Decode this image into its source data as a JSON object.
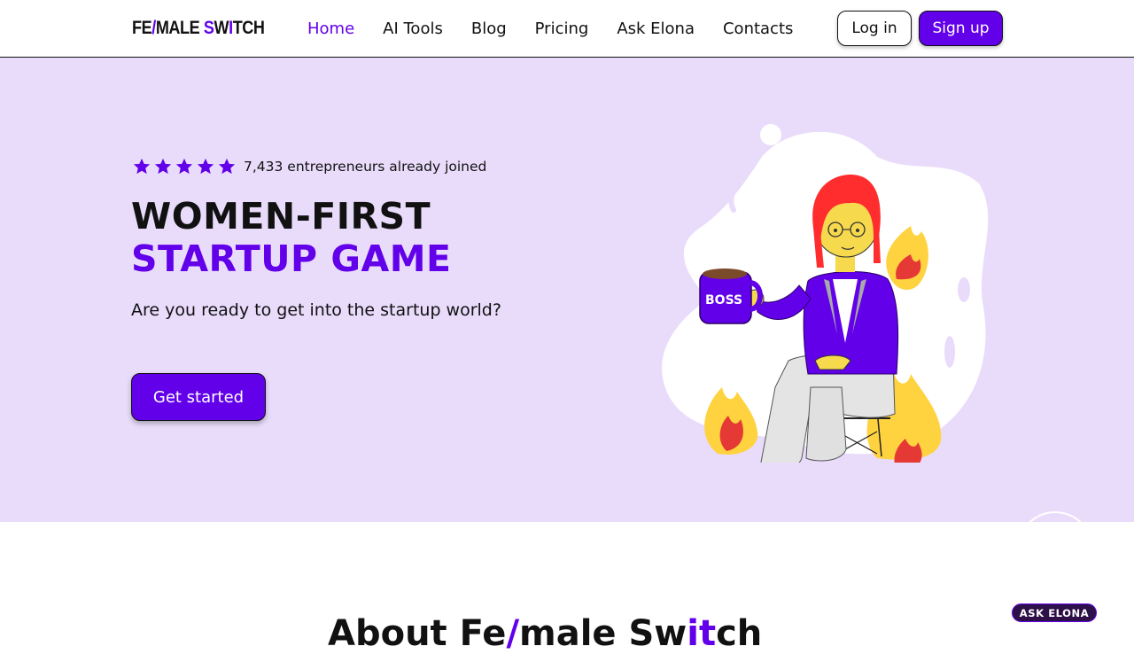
{
  "header": {
    "logo": {
      "part1": "FE",
      "slash": "/",
      "part2": "MALE ",
      "part3": "S",
      "part4": "W",
      "part5": "I",
      "part6": "T",
      "part7": "CH"
    },
    "nav": [
      {
        "label": "Home",
        "active": true
      },
      {
        "label": "AI Tools"
      },
      {
        "label": "Blog"
      },
      {
        "label": "Pricing"
      },
      {
        "label": "Ask Elona"
      },
      {
        "label": "Contacts"
      }
    ],
    "login_label": "Log in",
    "signup_label": "Sign up"
  },
  "hero": {
    "stars": 5,
    "rating_text": "7,433 entrepreneurs already joined",
    "title_line1": "WOMEN-FIRST",
    "title_line2": "STARTUP GAME",
    "subtitle": "Are you ready to get into the startup world?",
    "cta_label": "Get started",
    "mug_text": "BOSS"
  },
  "about": {
    "heading_part1": "About Fe",
    "heading_slash": "/",
    "heading_part2": "male Sw",
    "heading_part3": "it",
    "heading_part4": "ch"
  },
  "ask_badge": "ASK ELONA",
  "colors": {
    "accent": "#6200ea",
    "hero_bg": "#e9dcfb",
    "badge_bg": "#2e1048"
  }
}
